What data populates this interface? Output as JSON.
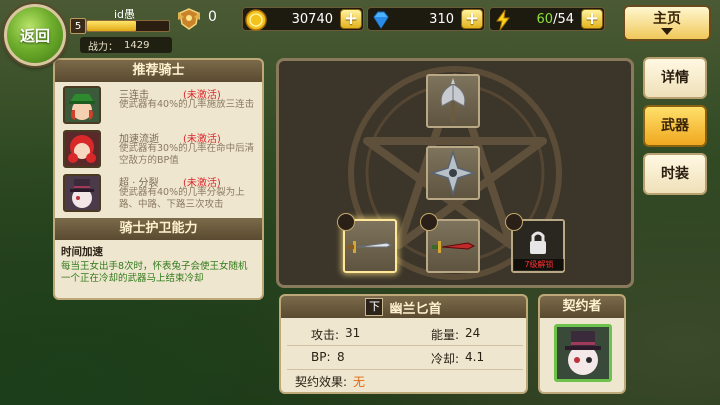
{
  "topbar": {
    "back_label": "返回",
    "player": {
      "level": "5",
      "name": "id愚",
      "xp_fraction": 0.6,
      "power_label": "战力：",
      "power_value": "1429"
    },
    "honor": {
      "icon": "honor-shield-icon",
      "value": "0"
    },
    "gold": {
      "icon": "gold-coin-icon",
      "value": "30740"
    },
    "diamond": {
      "icon": "diamond-icon",
      "value": "310"
    },
    "energy": {
      "icon": "lightning-icon",
      "value": "60",
      "max": "/54"
    },
    "plus_label": "+",
    "home_label": "主页"
  },
  "side_tabs": [
    {
      "label": "详情",
      "active": false
    },
    {
      "label": "武器",
      "active": true
    },
    {
      "label": "时装",
      "active": false
    }
  ],
  "recommended": {
    "title": "推荐骑士",
    "skills": [
      {
        "name": "三连击",
        "status": "(未激活)",
        "desc": "使武器有40%的几率施放三连击"
      },
      {
        "name": "加速流逝",
        "status": "(未激活)",
        "desc": "使武器有30%的几率在命中后清空敌方的BP值"
      },
      {
        "name": "超 · 分裂",
        "status": "(未激活)",
        "desc": "使武器有40%的几率分裂为上路、中路、下路三次攻击"
      }
    ]
  },
  "guard": {
    "title": "骑士护卫能力",
    "ability_name": "时间加速",
    "ability_desc": "每当王女出手8次时，怀表兔子会使王女随机一个正在冷却的武器马上结束冷却"
  },
  "board": {
    "lock_text": "7级解锁",
    "slots": [
      {
        "name": "axe-icon"
      },
      {
        "name": "shuriken-icon"
      },
      {
        "name": "sword-icon"
      },
      {
        "name": "dagger-icon"
      },
      {
        "name": "lock-icon"
      }
    ]
  },
  "weapon_info": {
    "grade": "下",
    "name": "幽兰匕首",
    "attack_label": "攻击:",
    "attack": "31",
    "energy_label": "能量:",
    "energy": "24",
    "bp_label": "BP:",
    "bp": "8",
    "cooldown_label": "冷却:",
    "cooldown": "4.1",
    "contract_label": "契约效果:",
    "contract_value": "无"
  },
  "contractor": {
    "title": "契约者"
  },
  "colors": {
    "accent_gold": "#f0c85a",
    "inactive_red": "#d8262a",
    "ability_green": "#2f7a1a",
    "panel_bg": "#efe6cf"
  }
}
